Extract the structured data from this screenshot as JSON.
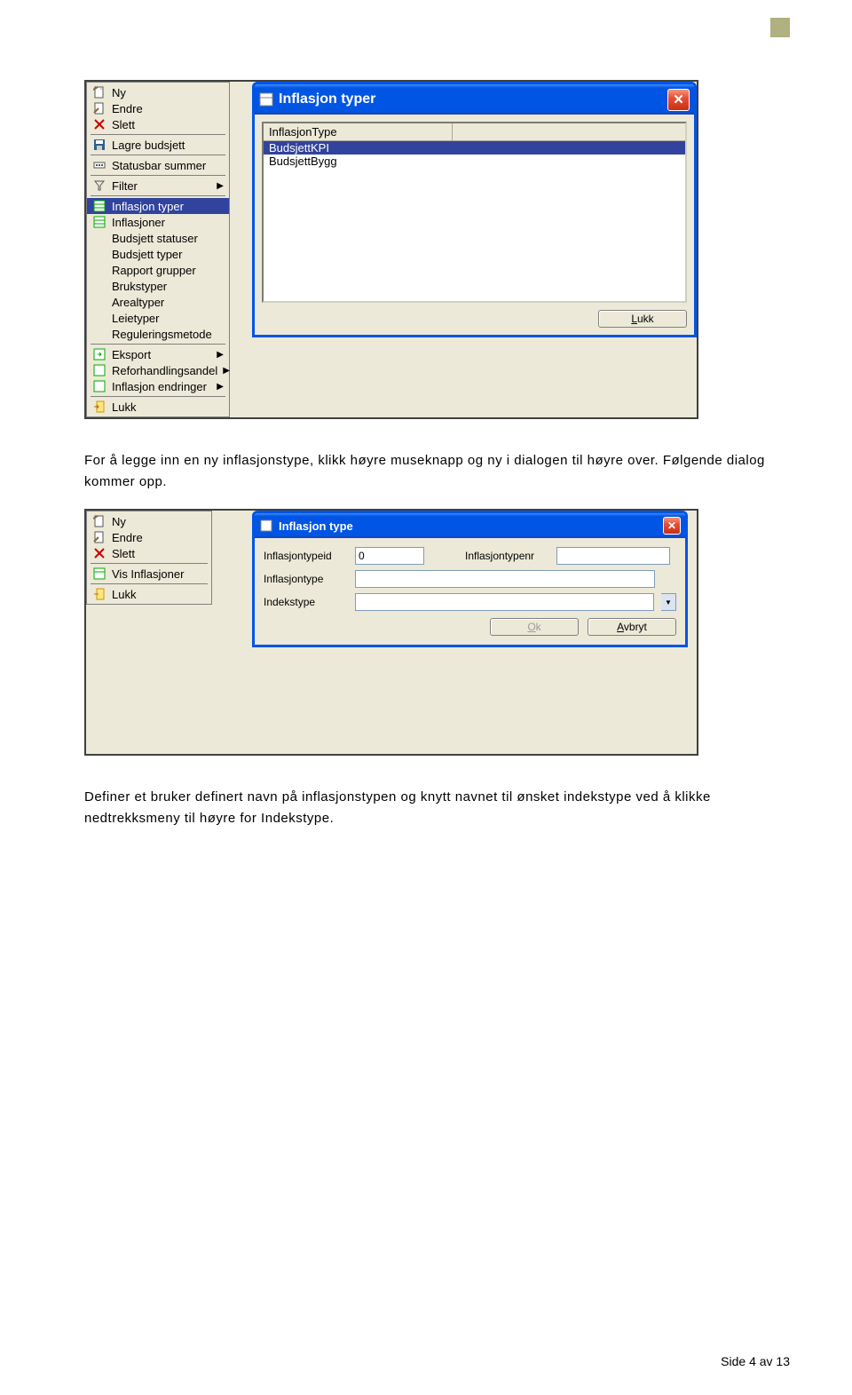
{
  "menu1": {
    "items": [
      {
        "icon": "new",
        "label": "Ny"
      },
      {
        "icon": "edit",
        "label": "Endre"
      },
      {
        "icon": "delete",
        "label": "Slett"
      },
      {
        "icon": "save",
        "label": "Lagre budsjett"
      },
      {
        "icon": "status",
        "label": "Statusbar summer"
      },
      {
        "icon": "filter",
        "label": "Filter",
        "arrow": true
      },
      {
        "icon": "sheet",
        "label": "Inflasjon typer",
        "selected": true
      },
      {
        "icon": "sheet",
        "label": "Inflasjoner"
      },
      {
        "icon": "none",
        "label": "Budsjett statuser"
      },
      {
        "icon": "none",
        "label": "Budsjett typer"
      },
      {
        "icon": "none",
        "label": "Rapport grupper"
      },
      {
        "icon": "none",
        "label": "Brukstyper"
      },
      {
        "icon": "none",
        "label": "Arealtyper"
      },
      {
        "icon": "none",
        "label": "Leietyper"
      },
      {
        "icon": "none",
        "label": "Reguleringsmetode"
      },
      {
        "icon": "export",
        "label": "Eksport",
        "arrow": true
      },
      {
        "icon": "export",
        "label": "Reforhandlingsandel",
        "arrow": true
      },
      {
        "icon": "export",
        "label": "Inflasjon endringer",
        "arrow": true
      },
      {
        "icon": "exit",
        "label": "Lukk"
      }
    ]
  },
  "dialog1": {
    "title": "Inflasjon typer",
    "header": "InflasjonType",
    "rows": [
      "BudsjettKPI",
      "BudsjettBygg"
    ],
    "close_button": "Lukk"
  },
  "para1": "For å legge inn en ny inflasjonstype, klikk høyre museknapp og ny i dialogen til høyre over. Følgende dialog kommer opp.",
  "menu2": {
    "items": [
      {
        "icon": "new",
        "label": "Ny"
      },
      {
        "icon": "edit",
        "label": "Endre"
      },
      {
        "icon": "delete",
        "label": "Slett"
      },
      {
        "icon": "sheet",
        "label": "Vis Inflasjoner"
      },
      {
        "icon": "exit",
        "label": "Lukk"
      }
    ]
  },
  "dialog2": {
    "title": "Inflasjon type",
    "labels": {
      "id": "Inflasjontypeid",
      "nr": "Inflasjontypenr",
      "type": "Inflasjontype",
      "index": "Indekstype"
    },
    "values": {
      "id": "0"
    },
    "ok": "Ok",
    "cancel": "Avbryt"
  },
  "para2": "Definer et bruker definert navn på inflasjonstypen og knytt navnet til ønsket indekstype ved å klikke nedtrekksmeny til høyre for Indekstype.",
  "footer": "Side 4 av 13"
}
